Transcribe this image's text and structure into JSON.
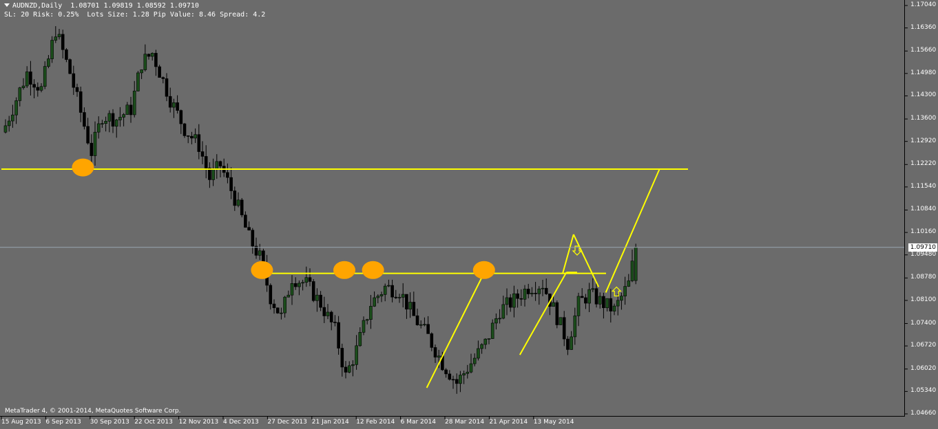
{
  "header": {
    "symbol_line": "AUDNZD,Daily  1.08701 1.09819 1.08592 1.09710",
    "info_line": "SL: 20 Risk: 0.25%  Lots Size: 1.28 Pip Value: 8.46 Spread: 4.2"
  },
  "footer": {
    "copyright": "MetaTrader 4, © 2001-2014, MetaQuotes Software Corp."
  },
  "current_price": "1.09710",
  "colors": {
    "background": "#6b6b6b",
    "bull_candle": "#1b4d1b",
    "bear_candle": "#000000",
    "wick": "#000000",
    "annotation": "#ffff00",
    "marker": "#ffa500",
    "bid_line": "#9aa6b2"
  },
  "chart_data": {
    "type": "candlestick",
    "ylim": [
      1.0466,
      1.1704
    ],
    "y_ticks": [
      "1.17040",
      "1.16360",
      "1.15660",
      "1.14980",
      "1.14300",
      "1.13600",
      "1.12920",
      "1.12220",
      "1.11540",
      "1.10840",
      "1.10160",
      "1.09480",
      "1.08780",
      "1.08100",
      "1.07400",
      "1.06720",
      "1.06020",
      "1.05340",
      "1.04660"
    ],
    "x_ticks": [
      "15 Aug 2013",
      "6 Sep 2013",
      "30 Sep 2013",
      "22 Oct 2013",
      "12 Nov 2013",
      "4 Dec 2013",
      "27 Dec 2013",
      "21 Jan 2014",
      "12 Feb 2014",
      "6 Mar 2014",
      "28 Mar 2014",
      "21 Apr 2014",
      "13 May 2014"
    ],
    "last_bar": {
      "open": 1.08701,
      "high": 1.09819,
      "low": 1.08592,
      "close": 1.0971
    },
    "close_path": [
      [
        0,
        1.134
      ],
      [
        6,
        1.15
      ],
      [
        10,
        1.145
      ],
      [
        14,
        1.163
      ],
      [
        18,
        1.15
      ],
      [
        21,
        1.138
      ],
      [
        24,
        1.126
      ],
      [
        27,
        1.137
      ],
      [
        31,
        1.136
      ],
      [
        35,
        1.139
      ],
      [
        38,
        1.153
      ],
      [
        41,
        1.156
      ],
      [
        46,
        1.142
      ],
      [
        50,
        1.133
      ],
      [
        54,
        1.128
      ],
      [
        57,
        1.118
      ],
      [
        60,
        1.122
      ],
      [
        64,
        1.112
      ],
      [
        68,
        1.1
      ],
      [
        71,
        1.094
      ],
      [
        74,
        1.082
      ],
      [
        77,
        1.076
      ],
      [
        80,
        1.088
      ],
      [
        84,
        1.086
      ],
      [
        88,
        1.08
      ],
      [
        92,
        1.072
      ],
      [
        95,
        1.058
      ],
      [
        98,
        1.066
      ],
      [
        102,
        1.08
      ],
      [
        106,
        1.085
      ],
      [
        110,
        1.084
      ],
      [
        114,
        1.076
      ],
      [
        118,
        1.07
      ],
      [
        122,
        1.062
      ],
      [
        126,
        1.056
      ],
      [
        130,
        1.062
      ],
      [
        134,
        1.068
      ],
      [
        138,
        1.078
      ],
      [
        142,
        1.081
      ],
      [
        146,
        1.085
      ],
      [
        150,
        1.086
      ],
      [
        154,
        1.076
      ],
      [
        157,
        1.068
      ],
      [
        160,
        1.08
      ],
      [
        163,
        1.083
      ],
      [
        167,
        1.08
      ],
      [
        170,
        1.078
      ],
      [
        174,
        1.086
      ],
      [
        176,
        1.097
      ]
    ],
    "annotations": {
      "horizontal_lines": [
        {
          "y": 1.1208
        },
        {
          "y": 1.0892
        }
      ],
      "support_points": [
        {
          "x": 22,
          "y": 1.1213
        },
        {
          "x": 72,
          "y": 1.0902
        },
        {
          "x": 95,
          "y": 1.0902
        },
        {
          "x": 103,
          "y": 1.0902
        },
        {
          "x": 134,
          "y": 1.0902
        }
      ],
      "lines": [
        {
          "x1": 118,
          "y1": 1.0545,
          "x2": 134,
          "y2": 1.0893
        },
        {
          "x1": 144,
          "y1": 1.0645,
          "x2": 157,
          "y2": 1.0895
        },
        {
          "x1": 157,
          "y1": 1.0895,
          "x2": 160,
          "y2": 1.0895
        },
        {
          "x1": 156,
          "y1": 1.0893,
          "x2": 159,
          "y2": 1.101
        },
        {
          "x1": 159,
          "y1": 1.101,
          "x2": 166,
          "y2": 1.0851
        },
        {
          "x1": 168,
          "y1": 1.0834,
          "x2": 183,
          "y2": 1.1208
        }
      ],
      "arrows": [
        {
          "x": 160,
          "y": 1.096,
          "dir": "down"
        },
        {
          "x": 171,
          "y": 1.0838,
          "dir": "up"
        }
      ]
    }
  }
}
